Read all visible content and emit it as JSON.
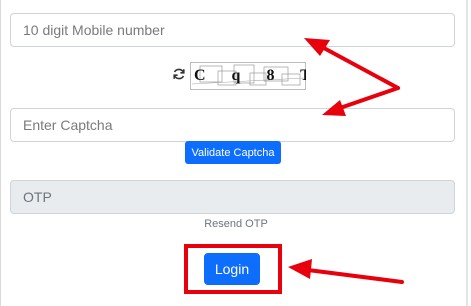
{
  "form": {
    "mobile_placeholder": "10 digit Mobile number",
    "captcha_placeholder": "Enter Captcha",
    "captcha_code": "C q 8 T Y 1",
    "validate_label": "Validate Captcha",
    "otp_placeholder": "OTP",
    "resend_label": "Resend OTP",
    "login_label": "Login"
  },
  "icons": {
    "refresh": "refresh-icon"
  },
  "colors": {
    "primary": "#0d6efd",
    "annotation": "#e8000d",
    "disabled_bg": "#e9ecef"
  }
}
